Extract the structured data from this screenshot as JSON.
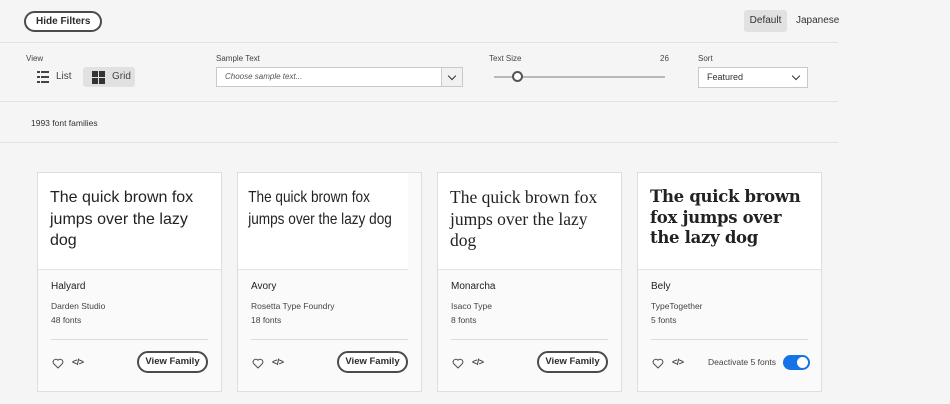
{
  "topbar": {
    "hide_filters_label": "Hide Filters",
    "lang_default": "Default",
    "lang_japanese": "Japanese"
  },
  "filters": {
    "view_label": "View",
    "list_label": "List",
    "grid_label": "Grid",
    "sample_text_label": "Sample Text",
    "sample_text_placeholder": "Choose sample text...",
    "text_size_label": "Text Size",
    "text_size_value": "26",
    "sort_label": "Sort",
    "sort_value": "Featured"
  },
  "results": {
    "count_label": "1993 font families"
  },
  "colors": {
    "accent": "#1473e6"
  },
  "cards": [
    {
      "preview": "The quick brown fox jumps over the lazy dog",
      "name": "Halyard",
      "foundry": "Darden Studio",
      "count": "48 fonts",
      "action_label": "View Family"
    },
    {
      "preview": "The quick brown fox jumps over the lazy dog",
      "name": "Avory",
      "foundry": "Rosetta Type Foundry",
      "count": "18 fonts",
      "action_label": "View Family"
    },
    {
      "preview": "The quick brown fox jumps over the lazy dog",
      "name": "Monarcha",
      "foundry": "Isaco Type",
      "count": "8 fonts",
      "action_label": "View Family"
    },
    {
      "preview": "The quick brown fox jumps over the lazy dog",
      "name": "Bely",
      "foundry": "TypeTogether",
      "count": "5 fonts",
      "action_label": "Deactivate 5 fonts",
      "toggle_on": true
    }
  ],
  "icons": {
    "favorite": "heart-icon",
    "embed": "code-icon",
    "list": "list-icon",
    "grid": "grid-icon"
  }
}
